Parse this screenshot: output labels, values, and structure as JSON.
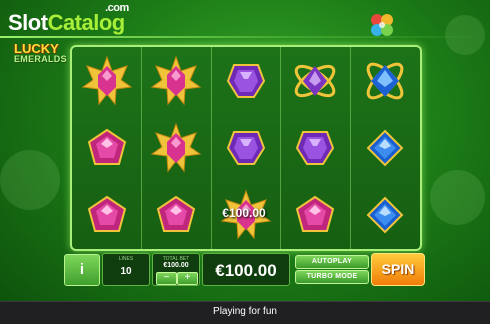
{
  "site": {
    "logo_main": "Slot",
    "logo_accent": "Catalog",
    "logo_suffix": ".com"
  },
  "game": {
    "logo_line1": "LUCKY",
    "logo_line2": "EMERALDS"
  },
  "reels": {
    "columns": [
      [
        "star",
        "pink-gem",
        "pink-gem"
      ],
      [
        "star",
        "star",
        "pink-gem"
      ],
      [
        "purple-gem",
        "purple-gem",
        "star"
      ],
      [
        "atom",
        "purple-gem",
        "pink-gem"
      ],
      [
        "blue-atom",
        "blue-gem",
        "blue-gem"
      ]
    ],
    "win_amount": "€100.00"
  },
  "controls": {
    "info_label": "i",
    "lines_label": "LINES",
    "lines_value": "10",
    "total_bet_label": "TOTAL BET",
    "total_bet_value": "€100.00",
    "minus_label": "−",
    "plus_label": "+",
    "balance_value": "€100.00",
    "win_label": "WIN",
    "win_value": "€100.00",
    "autoplay_label": "AUTOPLAY",
    "turbo_label": "TURBO MODE",
    "spin_label": "SPIN"
  },
  "footer": {
    "status_text": "Playing for fun"
  },
  "colors": {
    "background": "#1d7d17",
    "accent": "#a8ef3a",
    "spin": "#f5a01e"
  }
}
